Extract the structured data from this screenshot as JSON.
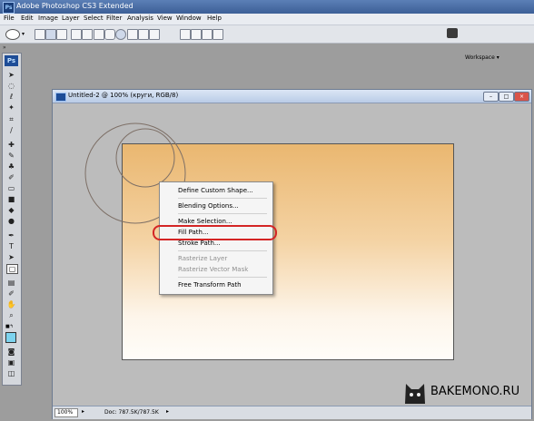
{
  "app": {
    "title": "Adobe Photoshop CS3 Extended",
    "badge": "Ps"
  },
  "menu": [
    "File",
    "Edit",
    "Image",
    "Layer",
    "Select",
    "Filter",
    "Analysis",
    "View",
    "Window",
    "Help"
  ],
  "options_bar": {
    "workspace_label": "Workspace ▾"
  },
  "document": {
    "title": "Untitled-2 @ 100% (круги, RGB/8)",
    "zoom": "100%",
    "doc_size": "Doc: 787.5K/787.5K"
  },
  "context_menu": {
    "items": [
      {
        "label": "Define Custom Shape...",
        "enabled": true
      },
      {
        "label": "Blending Options...",
        "enabled": true
      },
      {
        "label": "Make Selection...",
        "enabled": true
      },
      {
        "label": "Fill Path...",
        "enabled": true,
        "highlighted": true
      },
      {
        "label": "Stroke Path...",
        "enabled": true
      },
      {
        "label": "Rasterize Layer",
        "enabled": false
      },
      {
        "label": "Rasterize Vector Mask",
        "enabled": false
      },
      {
        "label": "Free Transform Path",
        "enabled": true
      }
    ]
  },
  "watermark": {
    "text": "BAKEMONO.RU"
  },
  "colors": {
    "accent_highlight": "#d42525",
    "canvas_top": "#eab770",
    "canvas_bottom": "#fffdf9",
    "titlebar": "#3c5f97"
  }
}
